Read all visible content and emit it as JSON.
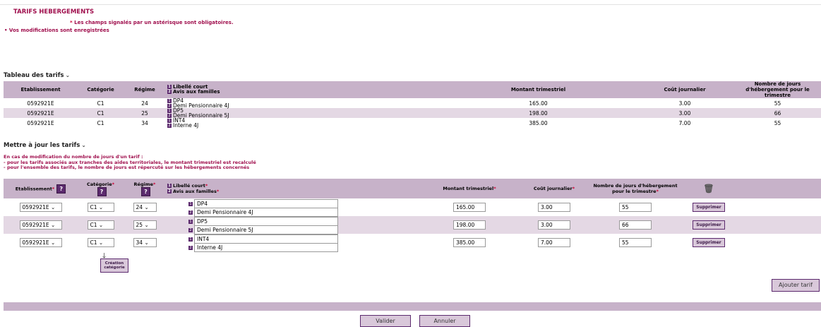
{
  "header": {
    "title": "TARIFS HEBERGEMENTS",
    "mandatory_star": "*",
    "mandatory_text": " Les champs signalés par un astérisque sont obligatoires.",
    "saved_msg": "• Vos modifications sont enregistrées"
  },
  "table1": {
    "title": "Tableau des tarifs",
    "chevron": "⌄",
    "headers": {
      "etablissement": "Etablissement",
      "categorie": "Catégorie",
      "regime": "Régime",
      "libelle_court": "Libellé court",
      "avis_familles": "Avis aux familles",
      "montant": "Montant trimestriel",
      "cout": "Coût journalier",
      "jours": "Nombre de jours d'hébergement pour le trimestre"
    },
    "rows": [
      {
        "etab": "0592921E",
        "cat": "C1",
        "regime": "24",
        "court": "DP4",
        "avis": "Demi Pensionnaire 4J",
        "montant": "165.00",
        "cout": "3.00",
        "jours": "55"
      },
      {
        "etab": "0592921E",
        "cat": "C1",
        "regime": "25",
        "court": "DP5",
        "avis": "Demi Pensionnaire 5J",
        "montant": "198.00",
        "cout": "3.00",
        "jours": "66"
      },
      {
        "etab": "0592921E",
        "cat": "C1",
        "regime": "34",
        "court": "INT4",
        "avis": "Interne 4J",
        "montant": "385.00",
        "cout": "7.00",
        "jours": "55"
      }
    ]
  },
  "update": {
    "title": "Mettre à jour les tarifs",
    "chevron": "⌄",
    "warn1": "En cas de modification du nombre de jours d'un tarif :",
    "warn2": "- pour les tarifs associés aux tranches des aides territoriales, le montant trimestriel est recalculé",
    "warn3": "- pour l'ensemble des tarifs, le nombre de jours est répercuté sur les hébergements concernés",
    "headers": {
      "etablissement": "Etablissement",
      "categorie": "Catégorie",
      "regime": "Régime",
      "libelle_court": "Libellé court",
      "avis_familles": "Avis aux familles",
      "montant": "Montant trimestriel",
      "cout": "Coût journalier",
      "jours": "Nombre de jours d'hébergement pour le trimestre"
    },
    "star": "*",
    "info_glyph": "?",
    "trash_glyph": "🗑",
    "chevron_select": "⌄",
    "rows": [
      {
        "etab": "0592921E",
        "cat": "C1",
        "regime": "24",
        "court": "DP4",
        "avis": "Demi Pensionnaire 4J",
        "montant": "165.00",
        "cout": "3.00",
        "jours": "55"
      },
      {
        "etab": "0592921E",
        "cat": "C1",
        "regime": "25",
        "court": "DP5",
        "avis": "Demi Pensionnaire 5J",
        "montant": "198.00",
        "cout": "3.00",
        "jours": "66"
      },
      {
        "etab": "0592921E",
        "cat": "C1",
        "regime": "34",
        "court": "INT4",
        "avis": "Interne 4J",
        "montant": "385.00",
        "cout": "7.00",
        "jours": "55"
      }
    ],
    "delete_label": "Supprimer",
    "arrow_glyph": "🡓",
    "create_cat_line1": "Création",
    "create_cat_line2": "catégorie",
    "add_label": "Ajouter tarif"
  },
  "footer": {
    "validate_label": "Valider",
    "cancel_label": "Annuler"
  },
  "badges": {
    "one": "1",
    "two": "2"
  }
}
